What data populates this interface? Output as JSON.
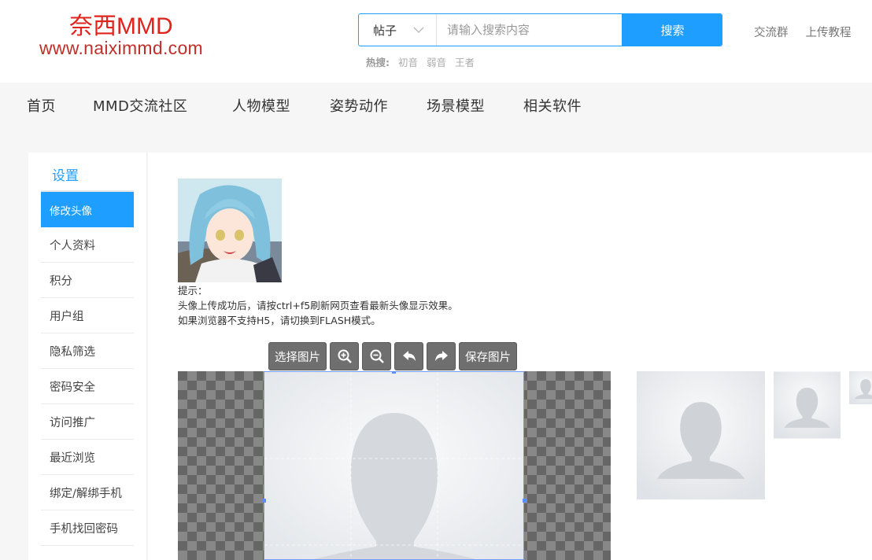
{
  "logo": {
    "line1": "奈西MMD",
    "line2": "www.naiximmd.com"
  },
  "search": {
    "type_selected": "帖子",
    "placeholder": "请输入搜索内容",
    "button": "搜索",
    "hot_label": "热搜:",
    "hot_terms": [
      "初音",
      "弱音",
      "王者"
    ]
  },
  "toplinks": [
    "交流群",
    "上传教程"
  ],
  "nav": [
    "首页",
    "MMD交流社区",
    "人物模型",
    "姿势动作",
    "场景模型",
    "相关软件"
  ],
  "sidebar": {
    "title": "设置",
    "items": [
      "修改头像",
      "个人资料",
      "积分",
      "用户组",
      "隐私筛选",
      "密码安全",
      "访问推广",
      "最近浏览",
      "绑定/解绑手机",
      "手机找回密码"
    ],
    "active_index": 0
  },
  "tips": {
    "title": "提示：",
    "line1": "头像上传成功后，请按ctrl+f5刷新网页查看最新头像显示效果。",
    "line2": "如果浏览器不支持H5，请切换到FLASH模式。"
  },
  "toolbar": {
    "select": "选择图片",
    "zoom_in_icon": "zoom-in-icon",
    "zoom_out_icon": "zoom-out-icon",
    "rotate_left_icon": "rotate-left-icon",
    "rotate_right_icon": "rotate-right-icon",
    "save": "保存图片"
  },
  "colors": {
    "accent": "#1e9fff",
    "logo_red": "#e0231c",
    "toolbar_btn": "#6f6f6f"
  }
}
